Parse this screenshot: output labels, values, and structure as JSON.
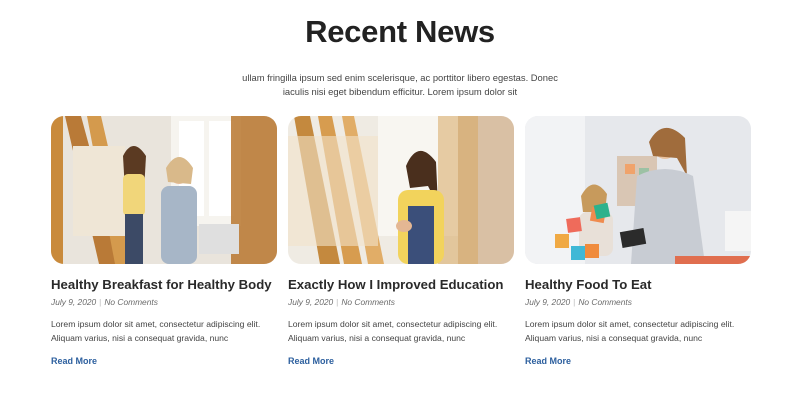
{
  "section": {
    "title": "Recent News",
    "subtitle": "ullam fringilla ipsum sed enim scelerisque, ac porttitor libero egestas. Donec iaculis nisi eget bibendum efficitur. Lorem ipsum dolor sit"
  },
  "posts": [
    {
      "title": "Healthy Breakfast for Healthy Body",
      "date": "July 9, 2020",
      "comments": "No Comments",
      "excerpt": "Lorem ipsum dolor sit amet, consectetur adipiscing elit. Aliquam varius, nisi a consequat gravida, nunc",
      "read_more": "Read More"
    },
    {
      "title": "Exactly How I Improved Education",
      "date": "July 9, 2020",
      "comments": "No Comments",
      "excerpt": "Lorem ipsum dolor sit amet, consectetur adipiscing elit. Aliquam varius, nisi a consequat gravida, nunc",
      "read_more": "Read More"
    },
    {
      "title": "Healthy Food To Eat",
      "date": "July 9, 2020",
      "comments": "No Comments",
      "excerpt": "Lorem ipsum dolor sit amet, consectetur adipiscing elit. Aliquam varius, nisi a consequat gravida, nunc",
      "read_more": "Read More"
    }
  ],
  "colors": {
    "accent_link": "#2c5f9e",
    "title": "#222222"
  }
}
